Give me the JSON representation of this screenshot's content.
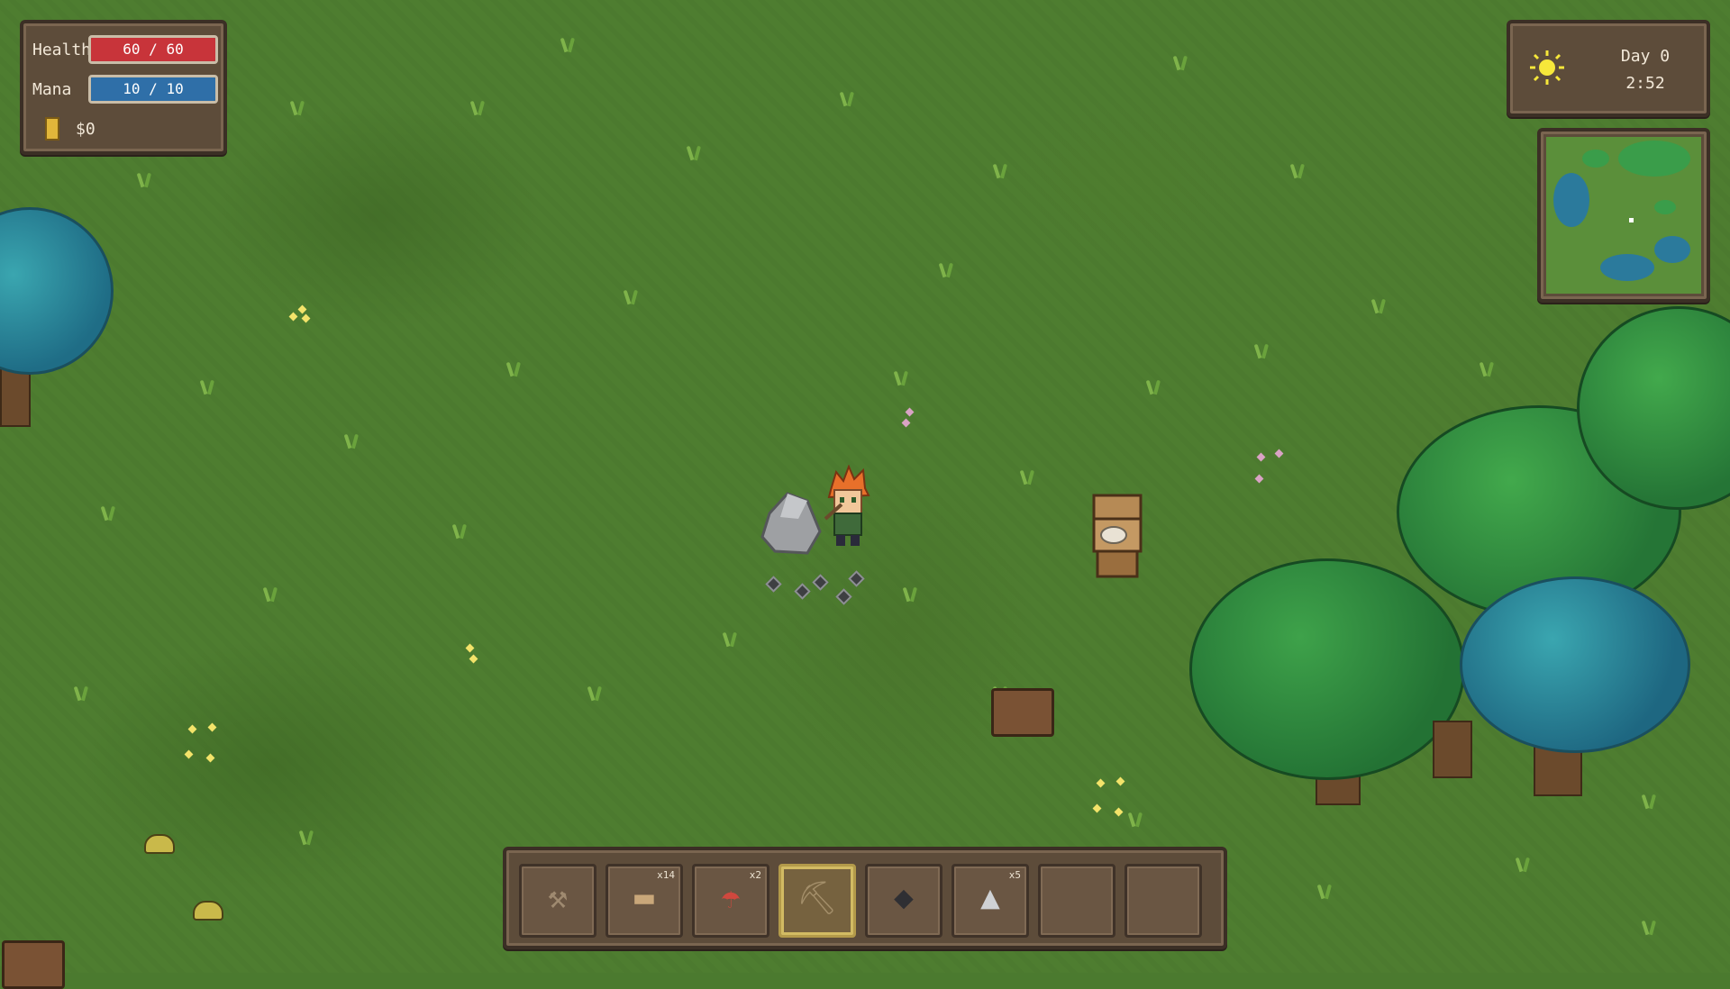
{
  "hud": {
    "health_label": "Health",
    "health_value": "60 / 60",
    "health_fraction": 1.0,
    "mana_label": "Mana",
    "mana_value": "10 / 10",
    "mana_fraction": 1.0,
    "money": "$0"
  },
  "clock": {
    "day": "Day 0",
    "time": "2:52",
    "weather_icon": "sun-icon"
  },
  "minimap": {
    "icon": "minimap"
  },
  "hotbar": {
    "selected_index": 3,
    "slots": [
      {
        "item": "axe-icon",
        "count": ""
      },
      {
        "item": "log-icon",
        "count": "x14"
      },
      {
        "item": "mushroom-icon",
        "count": "x2"
      },
      {
        "item": "pickaxe-icon",
        "count": ""
      },
      {
        "item": "coal-icon",
        "count": ""
      },
      {
        "item": "stone-icon",
        "count": "x5"
      },
      {
        "item": "empty",
        "count": ""
      },
      {
        "item": "empty",
        "count": ""
      }
    ]
  },
  "colors": {
    "health": "#c8343a",
    "mana": "#2f6fa8",
    "grass": "#4e7d30",
    "panel": "#5d4c3a"
  }
}
